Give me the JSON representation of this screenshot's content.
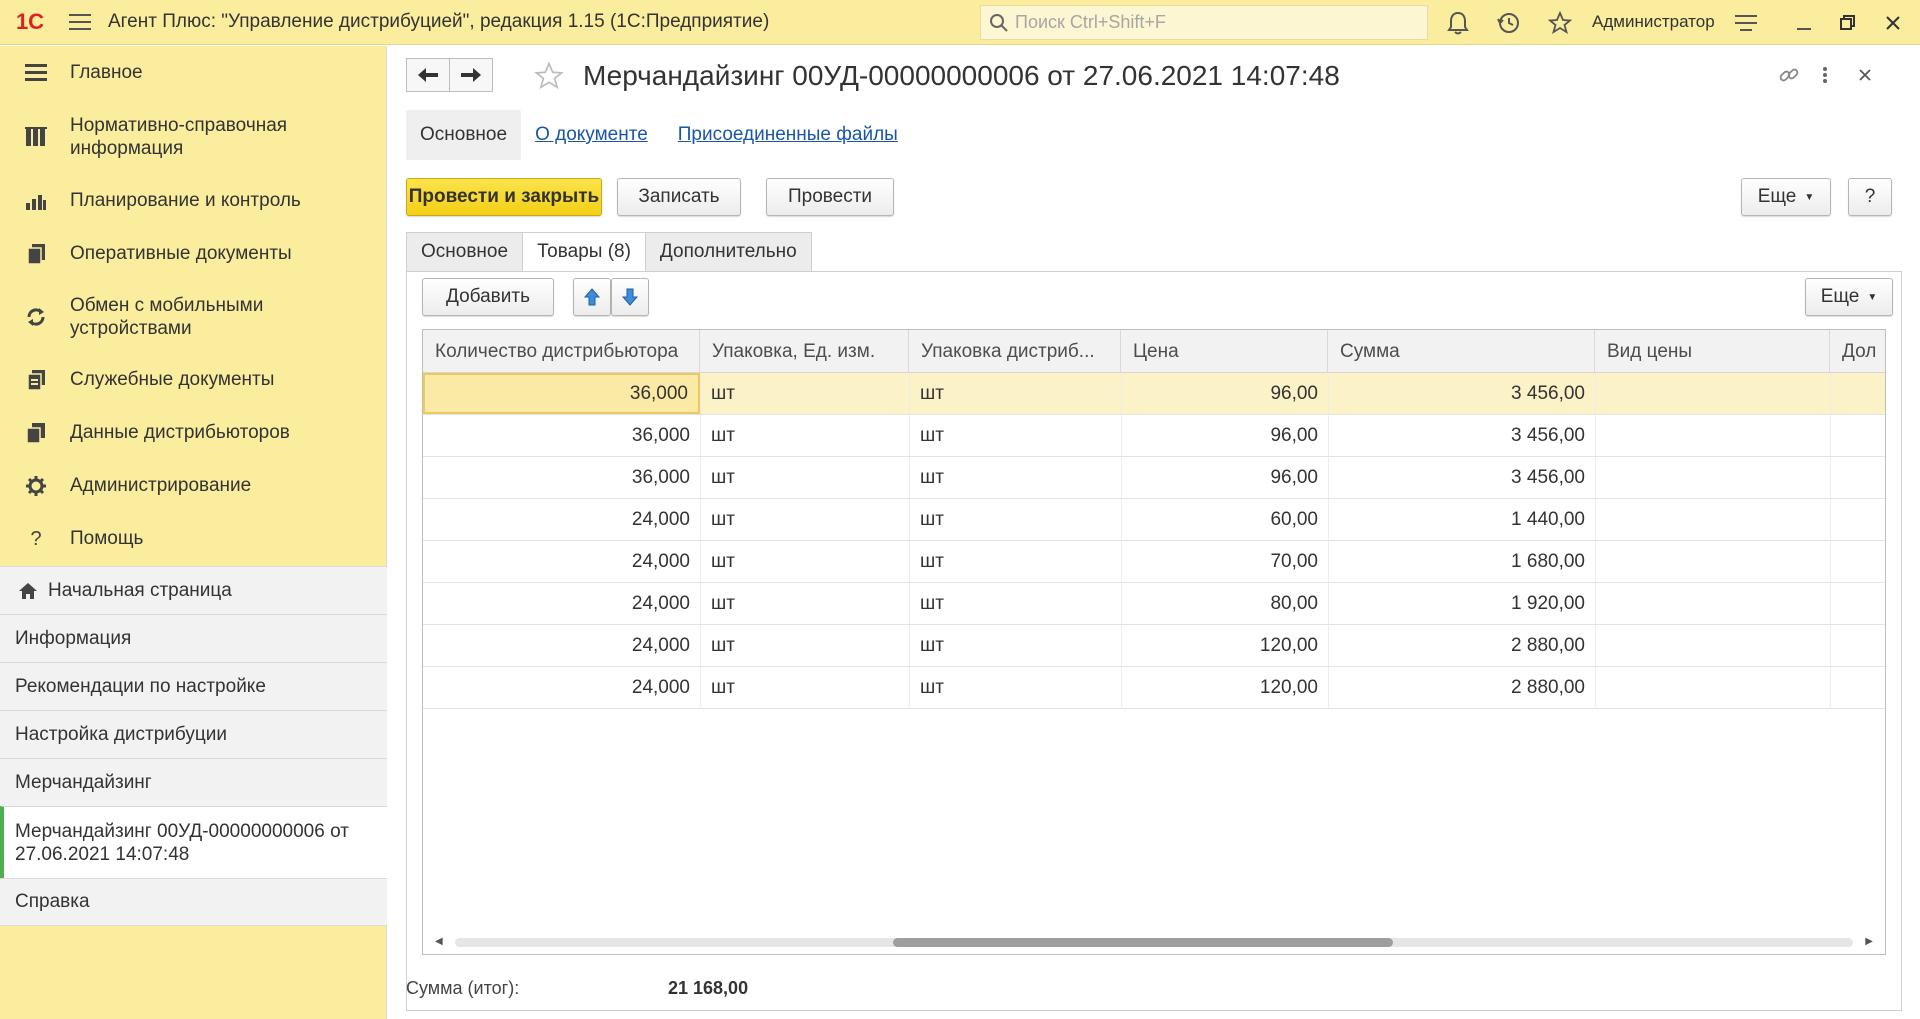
{
  "app": {
    "logo": "1С",
    "title": "Агент Плюс: \"Управление дистрибуцией\", редакция 1.15  (1С:Предприятие)",
    "search_placeholder": "Поиск Ctrl+Shift+F",
    "user": "Администратор"
  },
  "sidebar": {
    "sections": [
      {
        "label": "Главное",
        "icon": "menu-lines-icon"
      },
      {
        "label": "Нормативно-справочная информация",
        "icon": "catalog-icon"
      },
      {
        "label": "Планирование и контроль",
        "icon": "bar-chart-icon"
      },
      {
        "label": "Оперативные документы",
        "icon": "documents-icon"
      },
      {
        "label": "Обмен с мобильными устройствами",
        "icon": "sync-icon"
      },
      {
        "label": "Служебные документы",
        "icon": "service-docs-icon"
      },
      {
        "label": "Данные дистрибьюторов",
        "icon": "distributor-data-icon"
      },
      {
        "label": "Администрирование",
        "icon": "gear-icon"
      },
      {
        "label": "Помощь",
        "icon": "help-icon"
      }
    ],
    "open_windows": [
      {
        "label": "Начальная страница",
        "icon": "home-icon"
      },
      {
        "label": "Информация"
      },
      {
        "label": "Рекомендации по настройке"
      },
      {
        "label": "Настройка дистрибуции"
      },
      {
        "label": "Мерчандайзинг"
      },
      {
        "label": "Мерчандайзинг 00УД-00000000006 от 27.06.2021 14:07:48"
      },
      {
        "label": "Справка"
      }
    ]
  },
  "document": {
    "title": "Мерчандайзинг 00УД-00000000006 от 27.06.2021 14:07:48",
    "form_tabs": [
      "Основное",
      "О документе",
      "Присоединенные файлы"
    ],
    "buttons": {
      "post_close": "Провести и закрыть",
      "save": "Записать",
      "post": "Провести",
      "more": "Еще",
      "help": "?"
    },
    "page_tabs": [
      "Основное",
      "Товары (8)",
      "Дополнительно"
    ],
    "table_toolbar": {
      "add": "Добавить",
      "more": "Еще"
    },
    "columns": [
      "Количество дистрибьютора",
      "Упаковка, Ед. изм.",
      "Упаковка дистриб...",
      "Цена",
      "Сумма",
      "Вид цены",
      "Дол"
    ],
    "rows": [
      {
        "qty": "36,000",
        "pack": "шт",
        "pack_dist": "шт",
        "price": "96,00",
        "sum": "3 456,00",
        "price_type": ""
      },
      {
        "qty": "36,000",
        "pack": "шт",
        "pack_dist": "шт",
        "price": "96,00",
        "sum": "3 456,00",
        "price_type": ""
      },
      {
        "qty": "36,000",
        "pack": "шт",
        "pack_dist": "шт",
        "price": "96,00",
        "sum": "3 456,00",
        "price_type": ""
      },
      {
        "qty": "24,000",
        "pack": "шт",
        "pack_dist": "шт",
        "price": "60,00",
        "sum": "1 440,00",
        "price_type": ""
      },
      {
        "qty": "24,000",
        "pack": "шт",
        "pack_dist": "шт",
        "price": "70,00",
        "sum": "1 680,00",
        "price_type": ""
      },
      {
        "qty": "24,000",
        "pack": "шт",
        "pack_dist": "шт",
        "price": "80,00",
        "sum": "1 920,00",
        "price_type": ""
      },
      {
        "qty": "24,000",
        "pack": "шт",
        "pack_dist": "шт",
        "price": "120,00",
        "sum": "2 880,00",
        "price_type": ""
      },
      {
        "qty": "24,000",
        "pack": "шт",
        "pack_dist": "шт",
        "price": "120,00",
        "sum": "2 880,00",
        "price_type": ""
      }
    ],
    "total_label": "Сумма (итог):",
    "total_value": "21 168,00"
  },
  "colors": {
    "topbar": "#fbed9e",
    "primary_button": "#f3cf16",
    "link": "#1a56a6",
    "selected_row": "#fbf2c8",
    "active_marker": "#4caf50"
  }
}
